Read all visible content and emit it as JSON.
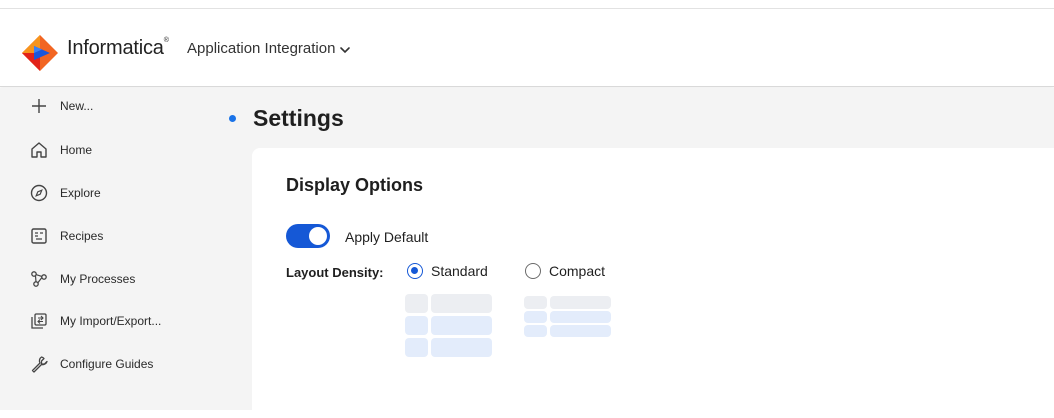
{
  "header": {
    "brand": "Informatica",
    "brand_mark": "®",
    "app_name": "Application Integration",
    "colors": {
      "logo_orange": "#f26522",
      "logo_red": "#e2231a",
      "logo_blue": "#1a56db"
    }
  },
  "sidebar": {
    "items": [
      {
        "label": "New...",
        "icon": "plus-icon"
      },
      {
        "label": "Home",
        "icon": "home-icon"
      },
      {
        "label": "Explore",
        "icon": "compass-icon"
      },
      {
        "label": "Recipes",
        "icon": "recipe-icon"
      },
      {
        "label": "My Processes",
        "icon": "process-icon"
      },
      {
        "label": "My Import/Export...",
        "icon": "import-export-icon"
      },
      {
        "label": "Configure Guides",
        "icon": "wrench-icon"
      }
    ]
  },
  "main": {
    "page_title": "Settings",
    "card": {
      "title": "Display Options",
      "apply_default": {
        "label": "Apply Default",
        "on": true
      },
      "layout_density": {
        "label": "Layout Density:",
        "options": [
          {
            "label": "Standard",
            "selected": true
          },
          {
            "label": "Compact",
            "selected": false
          }
        ]
      }
    },
    "colors": {
      "accent": "#1558d6",
      "title_dot": "#1a73e8"
    }
  }
}
